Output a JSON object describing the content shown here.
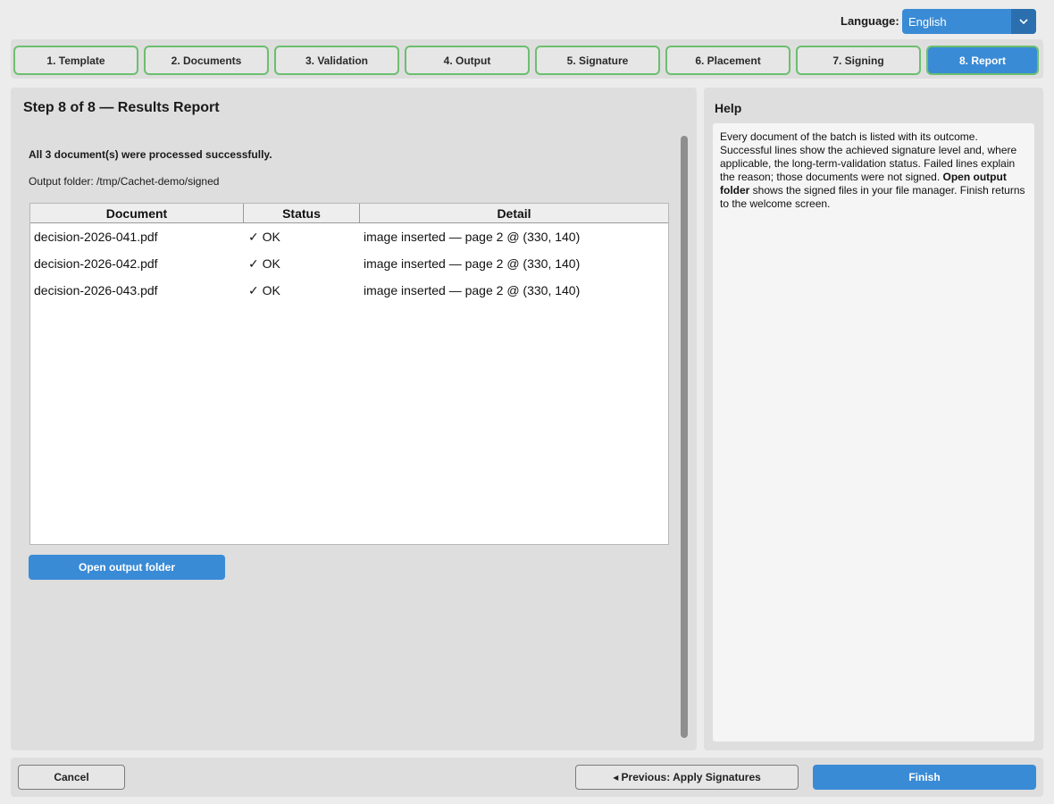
{
  "language": {
    "label": "Language:",
    "selected": "English"
  },
  "tabs": [
    {
      "label": "1. Template"
    },
    {
      "label": "2. Documents"
    },
    {
      "label": "3. Validation"
    },
    {
      "label": "4. Output"
    },
    {
      "label": "5. Signature"
    },
    {
      "label": "6. Placement"
    },
    {
      "label": "7. Signing"
    },
    {
      "label": "8. Report",
      "active": true
    }
  ],
  "main": {
    "title": "Step 8 of 8 — Results Report",
    "summary": "All 3 document(s) were processed successfully.",
    "output_folder": "Output folder: /tmp/Cachet-demo/signed",
    "table": {
      "headers": [
        "Document",
        "Status",
        "Detail"
      ],
      "rows": [
        [
          "decision-2026-041.pdf",
          "✓ OK",
          "image inserted — page 2 @ (330, 140)"
        ],
        [
          "decision-2026-042.pdf",
          "✓ OK",
          "image inserted — page 2 @ (330, 140)"
        ],
        [
          "decision-2026-043.pdf",
          "✓ OK",
          "image inserted — page 2 @ (330, 140)"
        ]
      ]
    },
    "open_folder_label": "Open output folder"
  },
  "help": {
    "title": "Help",
    "text_1": "Every document of the batch is listed with its outcome. Successful lines show the achieved signature level and, where applicable, the long-term-validation status. Failed lines explain the reason; those documents were not signed. ",
    "text_bold": "Open output folder",
    "text_2": " shows the signed files in your file manager. Finish returns to the welcome screen."
  },
  "footer": {
    "cancel_label": "Cancel",
    "previous_label": "◂  Previous: Apply Signatures",
    "finish_label": "Finish"
  },
  "colors": {
    "accent": "#3a8bd6",
    "tab_border": "#6cbf6e"
  }
}
